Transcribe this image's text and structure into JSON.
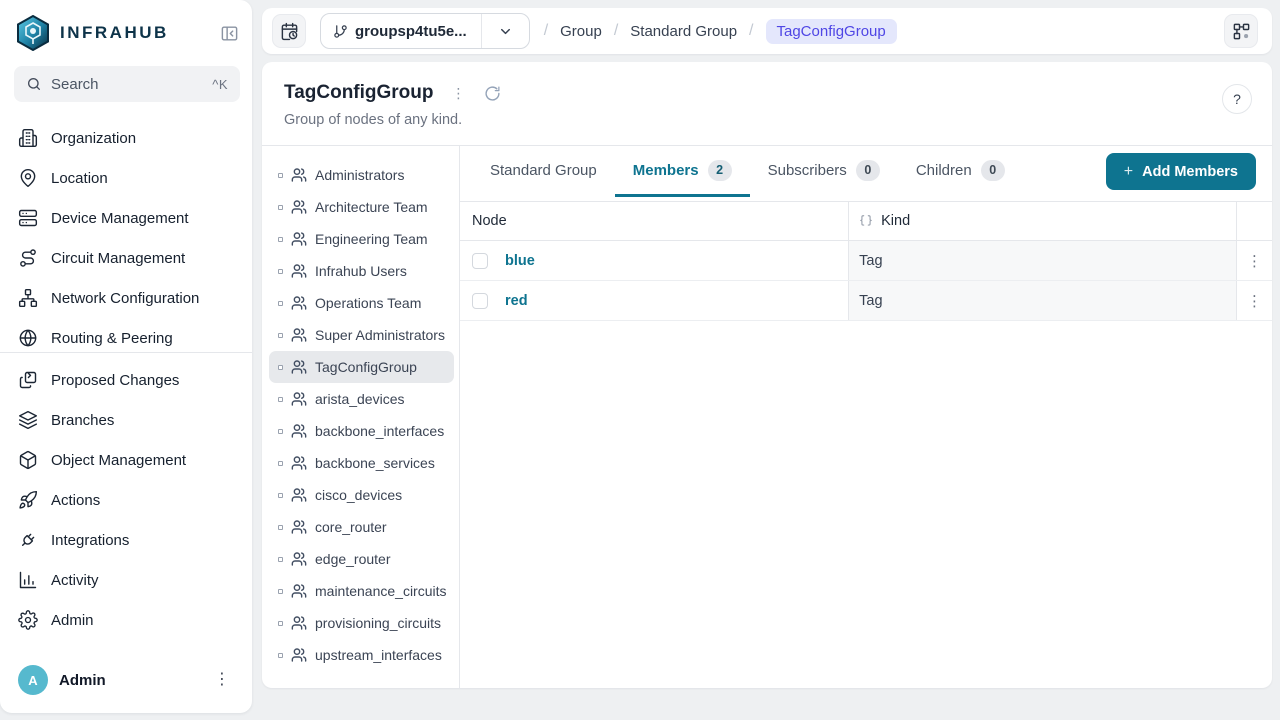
{
  "colors": {
    "accent": "#0e7490",
    "accent_dark": "#0c6a84",
    "indigo_text": "#4f46e5",
    "indigo_bg": "#e4e7fc",
    "avatar_bg": "#56b9ce",
    "page_bg": "#eef0f2"
  },
  "brand": {
    "name": "INFRAHUB"
  },
  "sidebar": {
    "search": {
      "placeholder": "Search",
      "shortcut": "^K"
    },
    "sections": [
      {
        "items": [
          {
            "icon": "building",
            "label": "Organization"
          },
          {
            "icon": "map-pin",
            "label": "Location"
          },
          {
            "icon": "server",
            "label": "Device Management"
          },
          {
            "icon": "route",
            "label": "Circuit Management"
          },
          {
            "icon": "network",
            "label": "Network Configuration"
          },
          {
            "icon": "globe",
            "label": "Routing & Peering"
          }
        ]
      },
      {
        "items": [
          {
            "icon": "git-compare",
            "label": "Proposed Changes"
          },
          {
            "icon": "layers",
            "label": "Branches"
          },
          {
            "icon": "box",
            "label": "Object Management"
          },
          {
            "icon": "rocket",
            "label": "Actions"
          },
          {
            "icon": "plug",
            "label": "Integrations"
          },
          {
            "icon": "bar-chart",
            "label": "Activity"
          },
          {
            "icon": "settings",
            "label": "Admin"
          }
        ]
      }
    ],
    "user": {
      "initial": "A",
      "name": "Admin"
    }
  },
  "topbar": {
    "branch": "groupsp4tu5e...",
    "separator": "/",
    "breadcrumb": [
      "Group",
      "Standard Group",
      "TagConfigGroup"
    ]
  },
  "page": {
    "title": "TagConfigGroup",
    "subtitle": "Group of nodes of any kind.",
    "help": "?"
  },
  "groups": {
    "items": [
      {
        "label": "Administrators"
      },
      {
        "label": "Architecture Team"
      },
      {
        "label": "Engineering Team"
      },
      {
        "label": "Infrahub Users"
      },
      {
        "label": "Operations Team"
      },
      {
        "label": "Super Administrators"
      },
      {
        "label": "TagConfigGroup",
        "selected": true
      },
      {
        "label": "arista_devices"
      },
      {
        "label": "backbone_interfaces"
      },
      {
        "label": "backbone_services"
      },
      {
        "label": "cisco_devices"
      },
      {
        "label": "core_router"
      },
      {
        "label": "edge_router"
      },
      {
        "label": "maintenance_circuits"
      },
      {
        "label": "provisioning_circuits"
      },
      {
        "label": "upstream_interfaces"
      }
    ]
  },
  "tabs": {
    "standard": {
      "label": "Standard Group"
    },
    "members": {
      "label": "Members",
      "count": 2
    },
    "subscribers": {
      "label": "Subscribers",
      "count": 0
    },
    "children": {
      "label": "Children",
      "count": 0
    }
  },
  "add_button": {
    "label": "Add Members"
  },
  "table": {
    "columns": {
      "node": "Node",
      "kind": "Kind"
    },
    "rows": [
      {
        "node": "blue",
        "kind": "Tag"
      },
      {
        "node": "red",
        "kind": "Tag"
      }
    ]
  }
}
